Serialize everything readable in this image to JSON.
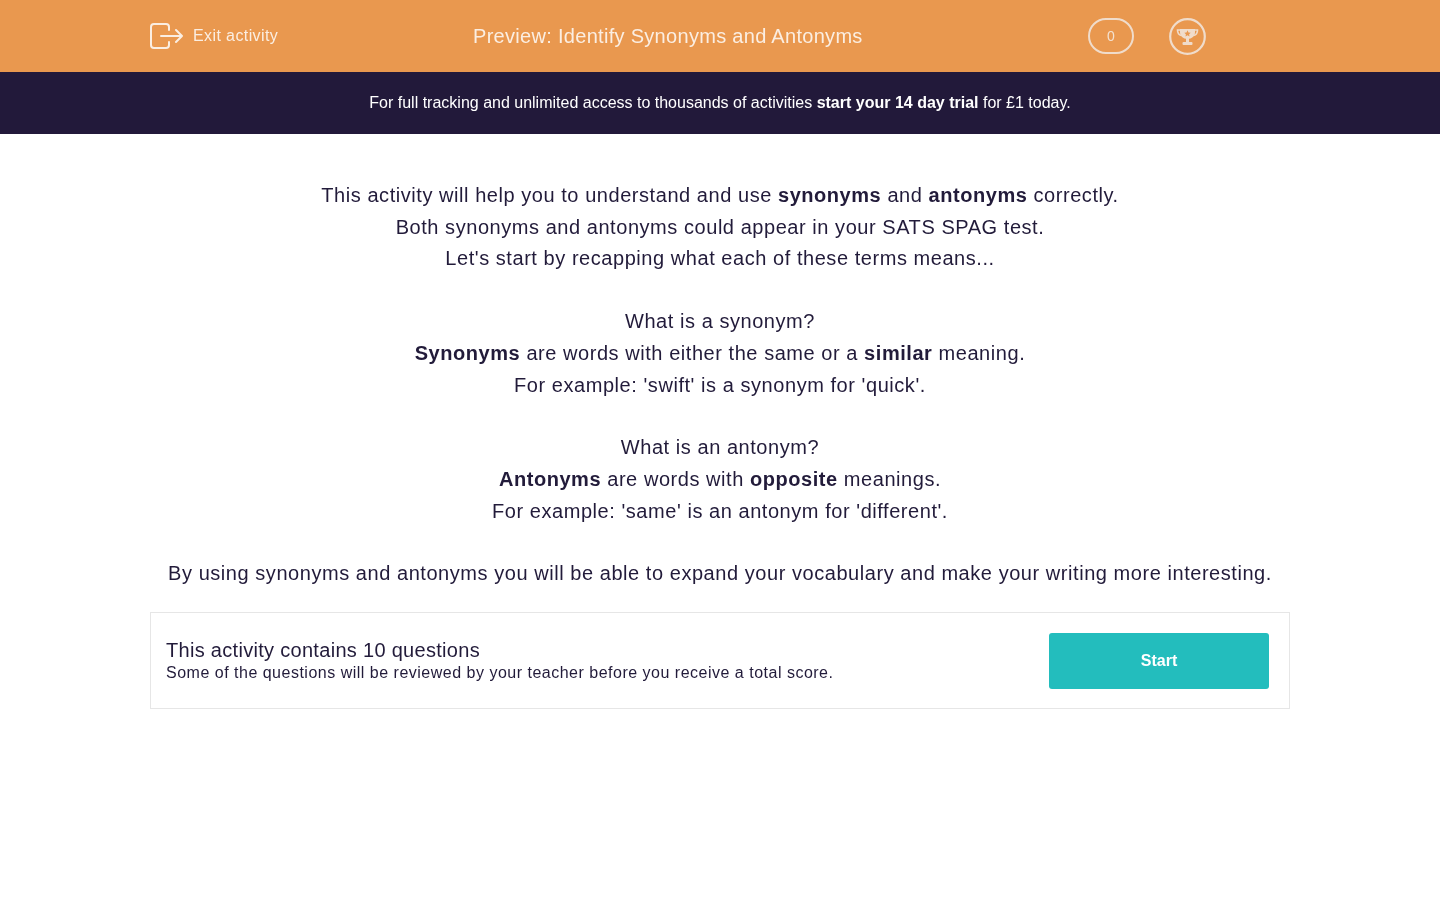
{
  "header": {
    "exit_label": "Exit activity",
    "title": "Preview: Identify Synonyms and Antonyms",
    "score": "0"
  },
  "banner": {
    "text": "For full tracking and unlimited access to thousands of activities **start your 14 day trial** for £1 today."
  },
  "intro": {
    "paragraphs": [
      [
        "This activity will help you to understand and use **synonyms** and **antonyms** correctly.",
        "Both synonyms and antonyms could appear in your SATS SPAG test.",
        "Let's start by recapping what each of these terms means..."
      ],
      [
        "What is a synonym?",
        "**Synonyms** are words with either the same or a **similar** meaning.",
        "For example: 'swift' is a synonym for 'quick'."
      ],
      [
        "What is an antonym?",
        "**Antonyms** are words with **opposite** meanings.",
        "For example: 'same' is an antonym for 'different'."
      ],
      [
        "By using synonyms and antonyms you will be able to expand your vocabulary and make your writing more interesting."
      ]
    ]
  },
  "summary": {
    "title": "This activity contains 10 questions",
    "note": "Some of the questions will be reviewed by your teacher before you receive a total score.",
    "button": "Start"
  }
}
